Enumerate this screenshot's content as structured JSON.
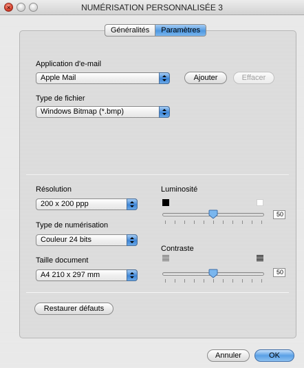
{
  "window": {
    "title": "NUMÉRISATION PERSONNALISÉE 3"
  },
  "tabs": [
    {
      "label": "Généralités",
      "active": false
    },
    {
      "label": "Paramètres",
      "active": true
    }
  ],
  "email": {
    "label": "Application d'e-mail",
    "value": "Apple Mail",
    "add_label": "Ajouter",
    "clear_label": "Effacer"
  },
  "filetype": {
    "label": "Type de fichier",
    "value": "Windows Bitmap (*.bmp)"
  },
  "resolution": {
    "label": "Résolution",
    "value": "200 x 200 ppp"
  },
  "scan_type": {
    "label": "Type de numérisation",
    "value": "Couleur 24 bits"
  },
  "doc_size": {
    "label": "Taille document",
    "value": "A4 210 x 297 mm"
  },
  "brightness": {
    "label": "Luminosité",
    "value": "50",
    "level": 0.5
  },
  "contrast": {
    "label": "Contraste",
    "value": "50",
    "level": 0.5
  },
  "restore_label": "Restaurer défauts",
  "footer": {
    "cancel_label": "Annuler",
    "ok_label": "OK"
  },
  "colors": {
    "accent": "#4f98e0",
    "close_button": "#d8402c"
  }
}
